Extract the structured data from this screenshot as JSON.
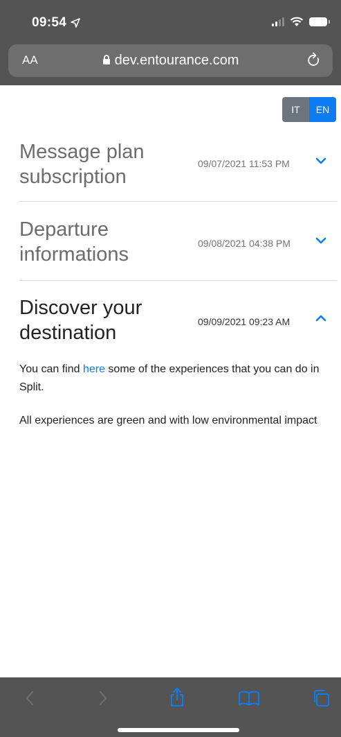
{
  "status_bar": {
    "time": "09:54"
  },
  "browser": {
    "text_size_label": "AA",
    "url": "dev.entourance.com"
  },
  "language_toggle": {
    "it_label": "IT",
    "en_label": "EN",
    "active": "EN"
  },
  "accordion": [
    {
      "title": "Message plan subscription",
      "date": "09/07/2021 11:53 PM",
      "expanded": false
    },
    {
      "title": "Departure informations",
      "date": "09/08/2021 04:38 PM",
      "expanded": false
    },
    {
      "title": "Discover your destination",
      "date": "09/09/2021 09:23 AM",
      "expanded": true
    }
  ],
  "expanded_content": {
    "p1_before": "You can find ",
    "p1_link": "here",
    "p1_after": " some of the experiences that you can do in Split.",
    "p2": "All experiences are green and with low environmental impact"
  },
  "colors": {
    "accent": "#0d7cf2",
    "chrome": "#545454",
    "muted_text": "#6c757d"
  }
}
